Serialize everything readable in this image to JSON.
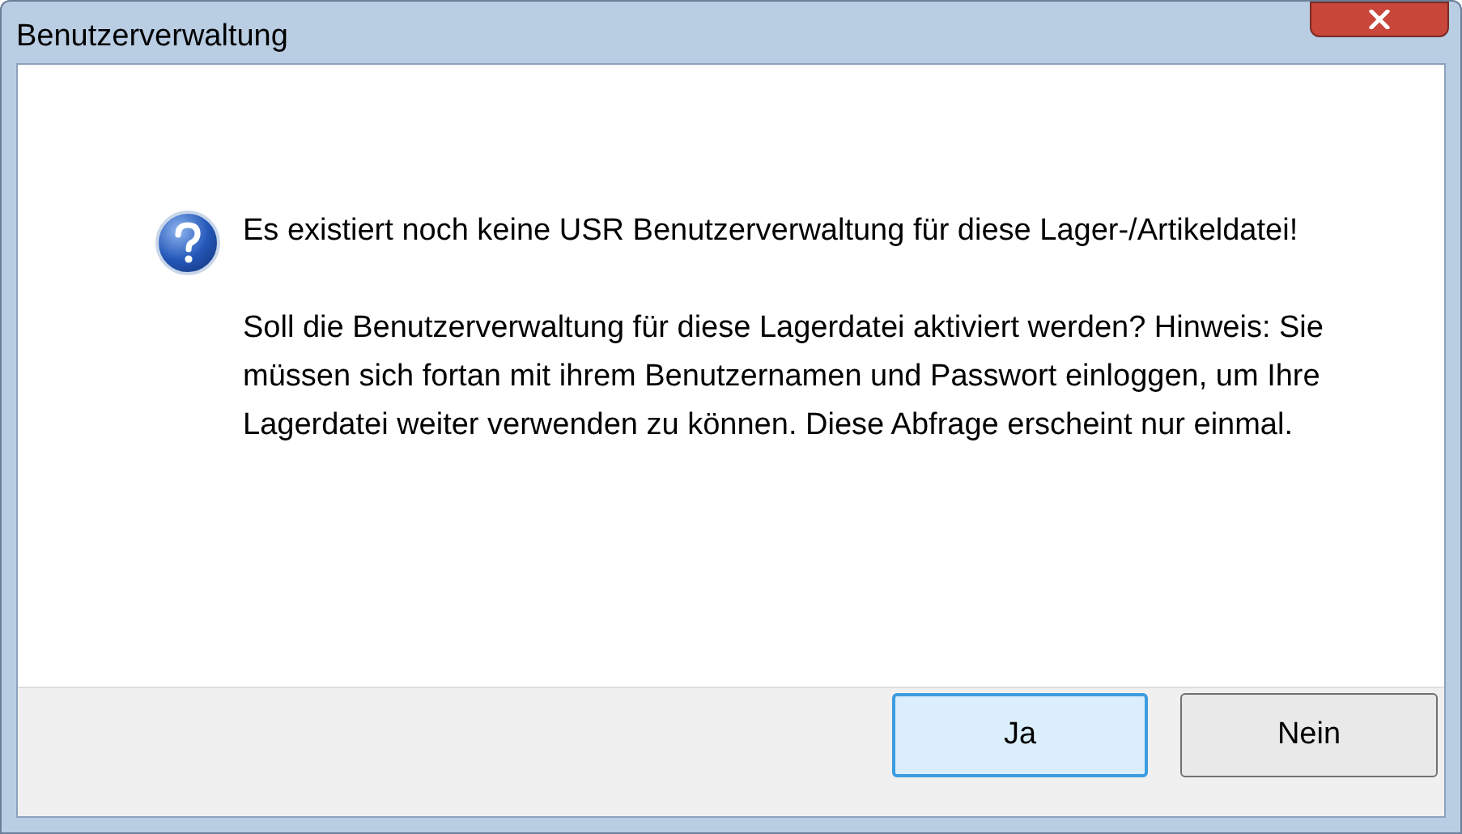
{
  "window": {
    "title": "Benutzerverwaltung"
  },
  "message": {
    "paragraphs": [
      "Es existiert noch keine USR Benutzerverwaltung für diese Lager-/Artikeldatei!",
      "Soll die Benutzerverwaltung für diese Lagerdatei aktiviert werden? Hinweis: Sie müssen sich fortan mit ihrem Benutzernamen und Passwort einloggen, um Ihre Lagerdatei weiter verwenden zu können. Diese Abfrage erscheint nur einmal."
    ]
  },
  "buttons": [
    {
      "label": "Ja",
      "focused": true
    },
    {
      "label": "Nein",
      "focused": false
    }
  ]
}
